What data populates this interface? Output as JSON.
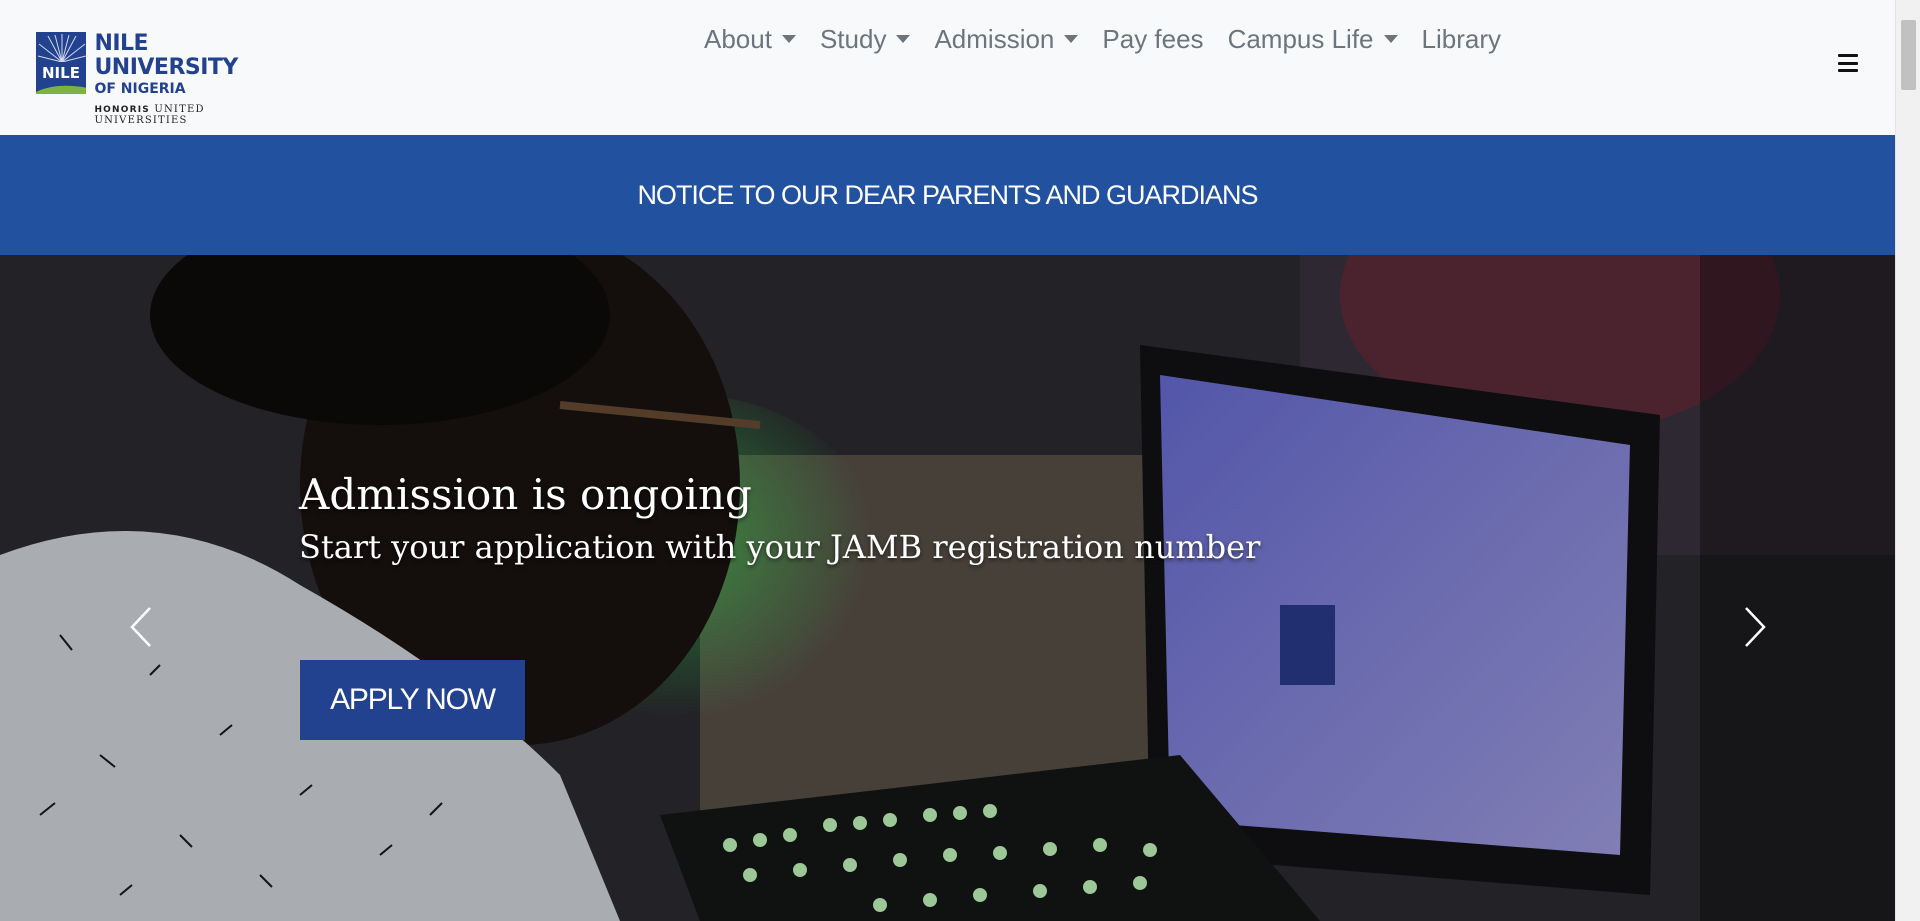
{
  "header": {
    "logo": {
      "mark_text": "NILE",
      "name": "NILE UNIVERSITY",
      "sub": "OF NIGERIA",
      "tagline_bold": "HONORIS",
      "tagline_rest": "UNITED UNIVERSITIES"
    },
    "nav": [
      {
        "label": "About",
        "dropdown": true
      },
      {
        "label": "Study",
        "dropdown": true
      },
      {
        "label": "Admission",
        "dropdown": true
      },
      {
        "label": "Pay fees",
        "dropdown": false
      },
      {
        "label": "Campus Life",
        "dropdown": true
      },
      {
        "label": "Library",
        "dropdown": false
      }
    ],
    "menu_icon": "hamburger-icon"
  },
  "notice": {
    "text": "NOTICE TO OUR DEAR PARENTS AND GUARDIANS"
  },
  "hero": {
    "title": "Admission is ongoing",
    "subtitle": "Start your application with your JAMB registration number",
    "cta_label": "APPLY NOW",
    "prev_icon": "chevron-left-icon",
    "next_icon": "chevron-right-icon"
  },
  "colors": {
    "brand_blue": "#22418f",
    "notice_blue": "#22519f",
    "accent_green": "#7cb342",
    "nav_text": "#6c757d"
  }
}
